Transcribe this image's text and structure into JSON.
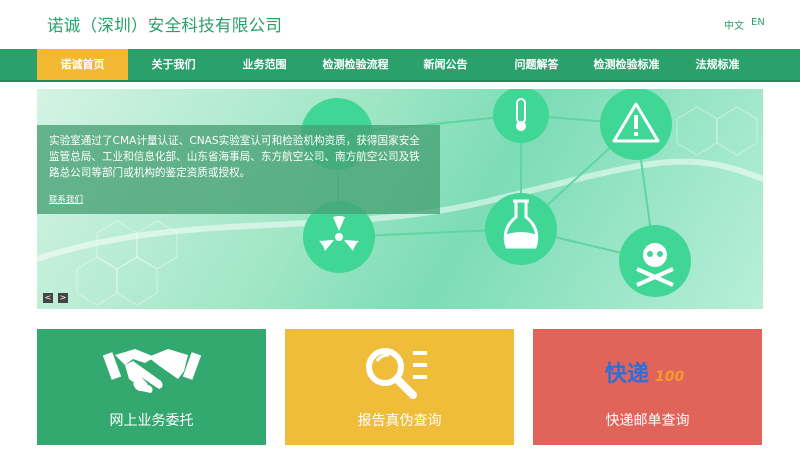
{
  "header": {
    "title": "诺诚（深圳）安全科技有限公司",
    "lang_zh": "中文",
    "lang_en": "EN"
  },
  "nav": {
    "items": [
      {
        "label": "诺诚首页",
        "active": true
      },
      {
        "label": "关于我们"
      },
      {
        "label": "业务范围"
      },
      {
        "label": "检测检验流程"
      },
      {
        "label": "新闻公告"
      },
      {
        "label": "问题解答"
      },
      {
        "label": "检测检验标准"
      },
      {
        "label": "法规标准"
      }
    ]
  },
  "banner": {
    "caption": "实验室通过了CMA计量认证、CNAS实验室认可和检验机构资质，获得国家安全监管总局、工业和信息化部、山东省海事局、东方航空公司、南方航空公司及铁路总公司等部门或机构的鉴定资质或授权。",
    "link": "联系我们",
    "prev": "<",
    "next": ">"
  },
  "cards": [
    {
      "label": "网上业务委托",
      "color": "#33a86f",
      "icon": "handshake-icon"
    },
    {
      "label": "报告真伪查询",
      "color": "#f0bd3a",
      "icon": "search-report-icon"
    },
    {
      "label": "快递邮单查询",
      "color": "#e0645a",
      "icon": "kuaidi-logo",
      "logo_text": "快递",
      "logo_suffix": "100"
    }
  ],
  "colors": {
    "brand_green": "#2aa06a",
    "nav_active": "#f2b733"
  }
}
